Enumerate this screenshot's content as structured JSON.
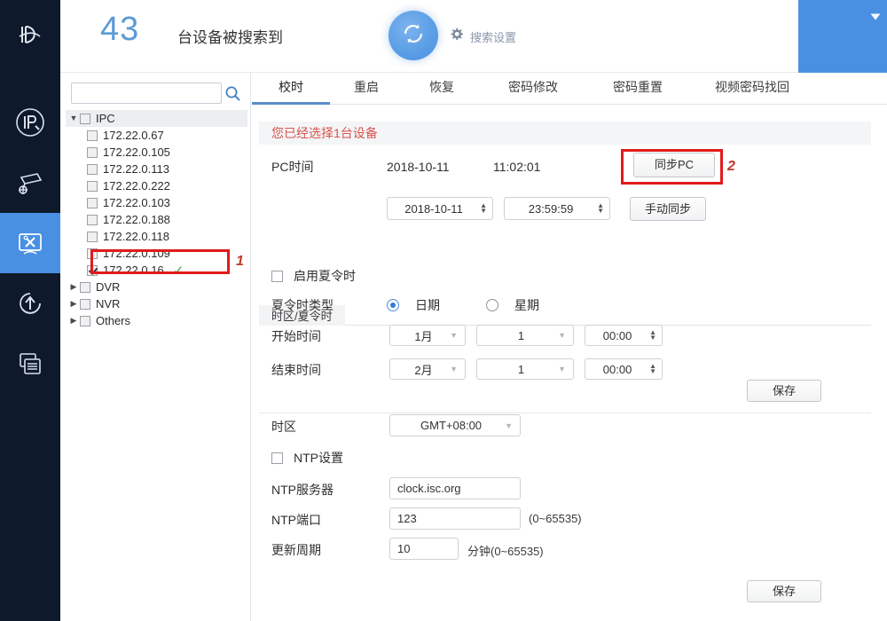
{
  "header": {
    "count": "43",
    "count_text": "台设备被搜索到",
    "refresh_icon": "refresh-icon",
    "settings_icon": "gear-icon",
    "settings_label": "搜索设置",
    "accent_blue": "#4a90e2",
    "window_buttons": [
      {
        "name": "collapse",
        "glyph": "▼"
      },
      {
        "name": "minimize",
        "glyph": "—"
      },
      {
        "name": "close",
        "glyph": "✕"
      }
    ]
  },
  "rail": {
    "logo_icon": "app-logo-icon",
    "items": [
      {
        "icon": "ip-config-icon",
        "active": false
      },
      {
        "icon": "camera-settings-icon",
        "active": false
      },
      {
        "icon": "device-tools-icon",
        "active": true
      },
      {
        "icon": "upgrade-icon",
        "active": false
      },
      {
        "icon": "logs-icon",
        "active": false
      }
    ]
  },
  "tree": {
    "search_value": "",
    "search_placeholder": "",
    "search_icon": "search-icon",
    "groups": [
      {
        "label": "IPC",
        "expanded": true,
        "checked": false,
        "children": [
          {
            "label": "172.22.0.67",
            "checked": false,
            "ok": false
          },
          {
            "label": "172.22.0.105",
            "checked": false,
            "ok": false
          },
          {
            "label": "172.22.0.113",
            "checked": false,
            "ok": false
          },
          {
            "label": "172.22.0.222",
            "checked": false,
            "ok": false
          },
          {
            "label": "172.22.0.103",
            "checked": false,
            "ok": false
          },
          {
            "label": "172.22.0.188",
            "checked": false,
            "ok": false
          },
          {
            "label": "172.22.0.118",
            "checked": false,
            "ok": false
          },
          {
            "label": "172.22.0.109",
            "checked": false,
            "ok": false
          },
          {
            "label": "172.22.0.16",
            "checked": true,
            "ok": true
          }
        ]
      },
      {
        "label": "DVR",
        "expanded": false,
        "checked": false,
        "children": []
      },
      {
        "label": "NVR",
        "expanded": false,
        "checked": false,
        "children": []
      },
      {
        "label": "Others",
        "expanded": false,
        "checked": false,
        "children": []
      }
    ]
  },
  "annotations": [
    {
      "label": "1",
      "target": "selected-device-row"
    },
    {
      "label": "2",
      "target": "sync-pc-button"
    }
  ],
  "tabs": [
    {
      "label": "校时",
      "active": true
    },
    {
      "label": "重启",
      "active": false
    },
    {
      "label": "恢复",
      "active": false
    },
    {
      "label": "密码修改",
      "active": false
    },
    {
      "label": "密码重置",
      "active": false
    },
    {
      "label": "视频密码找回",
      "active": false
    }
  ],
  "main": {
    "banner": "您已经选择1台设备",
    "pc_time_label": "PC时间",
    "pc_date": "2018-10-11",
    "pc_clock": "11:02:01",
    "sync_pc_button": "同步PC",
    "manual_date": "2018-10-11",
    "manual_time": "23:59:59",
    "manual_sync_button": "手动同步",
    "dst_tab": "时区/夏令时",
    "enable_dst_label": "启用夏令时",
    "enable_dst_checked": false,
    "dst_type_label": "夏令时类型",
    "dst_type_options": [
      {
        "label": "日期",
        "selected": true
      },
      {
        "label": "星期",
        "selected": false
      }
    ],
    "start_time_label": "开始时间",
    "start_month": "1月",
    "start_day": "1",
    "start_clock": "00:00",
    "end_time_label": "结束时间",
    "end_month": "2月",
    "end_day": "1",
    "end_clock": "00:00",
    "save_button_dst": "保存",
    "timezone_label": "时区",
    "timezone_value": "GMT+08:00",
    "ntp_enable_label": "NTP设置",
    "ntp_enable_checked": false,
    "ntp_server_label": "NTP服务器",
    "ntp_server_value": "clock.isc.org",
    "ntp_port_label": "NTP端口",
    "ntp_port_value": "123",
    "ntp_port_hint": "(0~65535)",
    "interval_label": "更新周期",
    "interval_value": "10",
    "interval_hint": "分钟(0~65535)",
    "save_button_ntp": "保存"
  }
}
